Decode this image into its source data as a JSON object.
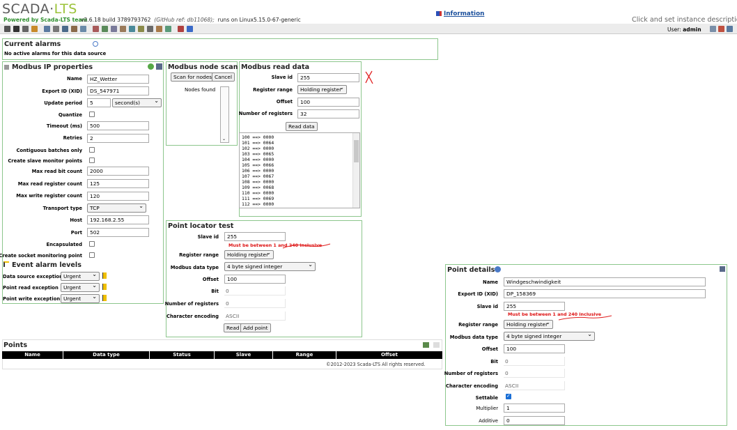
{
  "header": {
    "logo_main": "SCADA·",
    "logo_accent": "LTS",
    "powered": "Powered by Scada-LTS team",
    "version": "v2.6.18 build 3789793762",
    "git_ref": "(GitHub ref: db11068);",
    "runs_on": "runs on Linux5.15.0-67-generic",
    "info_link": "Information",
    "instance_desc": "Click and set instance descriptio",
    "user_label": "User:",
    "user_name": "admin"
  },
  "alarms": {
    "title": "Current alarms",
    "message": "No active alarms for this data source"
  },
  "modbus_ip": {
    "title": "Modbus IP properties",
    "name_label": "Name",
    "name_value": "HZ_Wetter",
    "xid_label": "Export ID (XID)",
    "xid_value": "DS_547971",
    "update_label": "Update period",
    "update_value": "5",
    "update_unit": "second(s)",
    "quantize_label": "Quantize",
    "timeout_label": "Timeout (ms)",
    "timeout_value": "500",
    "retries_label": "Retries",
    "retries_value": "2",
    "contiguous_label": "Contiguous batches only",
    "slave_monitor_label": "Create slave monitor points",
    "max_bit_label": "Max read bit count",
    "max_bit_value": "2000",
    "max_reg_label": "Max read register count",
    "max_reg_value": "125",
    "max_write_label": "Max write register count",
    "max_write_value": "120",
    "transport_label": "Transport type",
    "transport_value": "TCP",
    "host_label": "Host",
    "host_value": "192.168.2.55",
    "port_label": "Port",
    "port_value": "502",
    "encap_label": "Encapsulated",
    "socket_label": "Create socket monitoring point"
  },
  "event_alarms": {
    "title": "Event alarm levels",
    "rows": [
      {
        "label": "Data source exception",
        "value": "Urgent"
      },
      {
        "label": "Point read exception",
        "value": "Urgent"
      },
      {
        "label": "Point write exception",
        "value": "Urgent"
      }
    ]
  },
  "node_scan": {
    "title": "Modbus node scan",
    "scan_button": "Scan for nodes",
    "cancel_button": "Cancel",
    "found_label": "Nodes found"
  },
  "read_data": {
    "title": "Modbus read data",
    "slave_label": "Slave id",
    "slave_value": "255",
    "range_label": "Register range",
    "range_value": "Holding register",
    "offset_label": "Offset",
    "offset_value": "100",
    "count_label": "Number of registers",
    "count_value": "32",
    "read_button": "Read data",
    "results": "100 ==> 0000\n101 ==> 0064\n102 ==> 0000\n103 ==> 0065\n104 ==> 0000\n105 ==> 0066\n106 ==> 0000\n107 ==> 0067\n108 ==> 0000\n109 ==> 0068\n110 ==> 0000\n111 ==> 0069\n112 ==> 0000\n113 ==> 006a"
  },
  "locator_test": {
    "title": "Point locator test",
    "slave_label": "Slave id",
    "slave_value": "255",
    "error": "Must be between 1 and 240 inclusive",
    "range_label": "Register range",
    "range_value": "Holding register",
    "type_label": "Modbus data type",
    "type_value": "4 byte signed integer",
    "offset_label": "Offset",
    "offset_value": "100",
    "bit_label": "Bit",
    "bit_value": "0",
    "nreg_label": "Number of registers",
    "nreg_value": "0",
    "enc_label": "Character encoding",
    "enc_value": "ASCII",
    "read_button": "Read",
    "add_button": "Add point"
  },
  "points": {
    "title": "Points",
    "columns": [
      "Name",
      "Data type",
      "Status",
      "Slave",
      "Range",
      "Offset"
    ],
    "copyright": "©2012-2023 Scada-LTS All rights reserved."
  },
  "point_details": {
    "title": "Point details",
    "name_label": "Name",
    "name_value": "Windgeschwindigkeit",
    "xid_label": "Export ID (XID)",
    "xid_value": "DP_158369",
    "slave_label": "Slave id",
    "slave_value": "255",
    "error": "Must be between 1 and 240 inclusive",
    "range_label": "Register range",
    "range_value": "Holding register",
    "type_label": "Modbus data type",
    "type_value": "4 byte signed integer",
    "offset_label": "Offset",
    "offset_value": "100",
    "bit_label": "Bit",
    "bit_value": "0",
    "nreg_label": "Number of registers",
    "nreg_value": "0",
    "enc_label": "Character encoding",
    "enc_value": "ASCII",
    "settable_label": "Settable",
    "mult_label": "Multiplier",
    "mult_value": "1",
    "add_label": "Additive",
    "add_value": "0"
  },
  "colors": {
    "panel_border": "#8cc68c",
    "error": "#dd1111",
    "annotation": "#e02020",
    "brand_green": "#9cc33a"
  }
}
